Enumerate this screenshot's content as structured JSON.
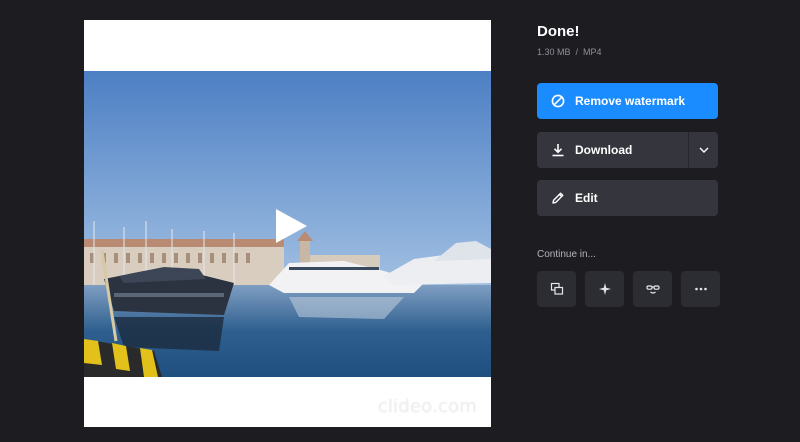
{
  "preview": {
    "watermark": "clideo.com"
  },
  "result": {
    "title": "Done!",
    "file_size": "1.30 MB",
    "separator": "/",
    "format": "MP4"
  },
  "actions": {
    "remove_watermark": "Remove watermark",
    "download": "Download",
    "edit": "Edit"
  },
  "continue": {
    "label": "Continue in...",
    "tools": [
      {
        "icon": "layers-icon"
      },
      {
        "icon": "sparkle-icon"
      },
      {
        "icon": "meme-face-icon"
      },
      {
        "icon": "more-icon"
      }
    ]
  },
  "colors": {
    "background": "#1c1c21",
    "accent": "#1a8cff",
    "button": "#35353d",
    "tool_button": "#2c2c33"
  }
}
